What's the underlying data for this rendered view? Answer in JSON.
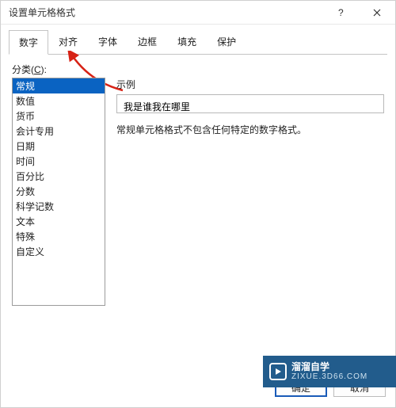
{
  "window": {
    "title": "设置单元格格式"
  },
  "tabs": [
    {
      "label": "数字",
      "active": true
    },
    {
      "label": "对齐",
      "active": false
    },
    {
      "label": "字体",
      "active": false
    },
    {
      "label": "边框",
      "active": false
    },
    {
      "label": "填充",
      "active": false
    },
    {
      "label": "保护",
      "active": false
    }
  ],
  "category": {
    "label_prefix": "分类(",
    "label_hotkey": "C",
    "label_suffix": "):",
    "items": [
      {
        "label": "常规",
        "selected": true
      },
      {
        "label": "数值",
        "selected": false
      },
      {
        "label": "货币",
        "selected": false
      },
      {
        "label": "会计专用",
        "selected": false
      },
      {
        "label": "日期",
        "selected": false
      },
      {
        "label": "时间",
        "selected": false
      },
      {
        "label": "百分比",
        "selected": false
      },
      {
        "label": "分数",
        "selected": false
      },
      {
        "label": "科学记数",
        "selected": false
      },
      {
        "label": "文本",
        "selected": false
      },
      {
        "label": "特殊",
        "selected": false
      },
      {
        "label": "自定义",
        "selected": false
      }
    ]
  },
  "example": {
    "label": "示例",
    "value": "我是谁我在哪里"
  },
  "description": "常规单元格格式不包含任何特定的数字格式。",
  "buttons": {
    "ok": "确定",
    "cancel": "取消"
  },
  "watermark": {
    "brand": "溜溜自学",
    "domain": "ZIXUE.3D66.COM"
  }
}
